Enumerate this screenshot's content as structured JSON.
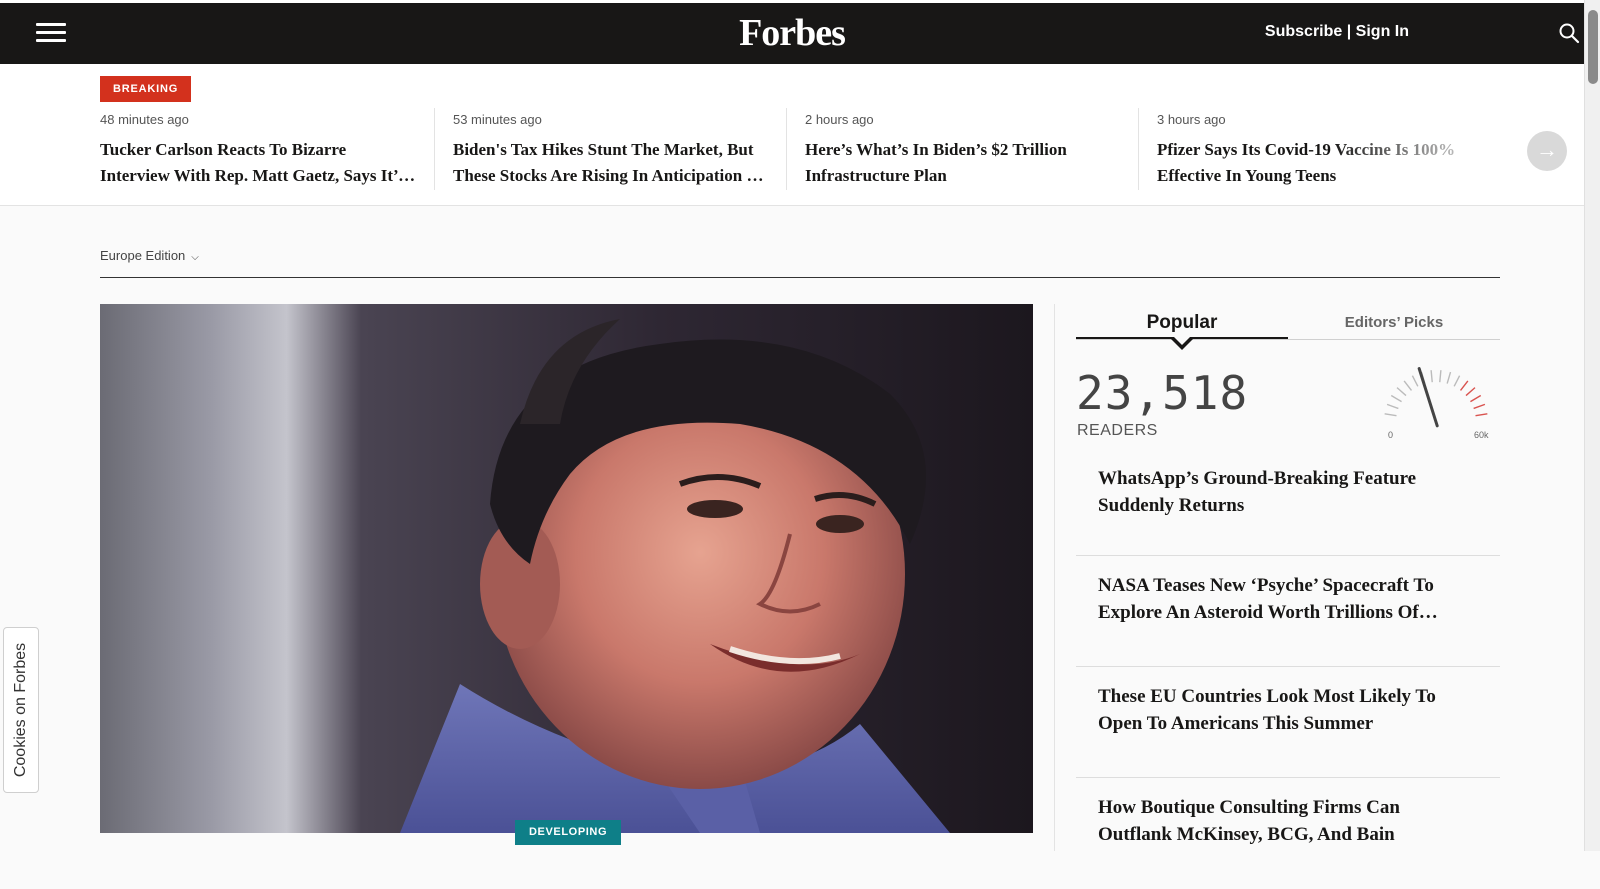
{
  "header": {
    "logo_text": "Forbes",
    "subscribe_label": "Subscribe",
    "separator": "|",
    "sign_in_label": "Sign In"
  },
  "breaking": {
    "badge": "BREAKING",
    "next_arrow": "→",
    "items": [
      {
        "time": "48 minutes ago",
        "title": "Tucker Carlson Reacts To Bizarre Interview With Rep. Matt Gaetz, Says It’s One Of The Weirdest He’s Done"
      },
      {
        "time": "53 minutes ago",
        "title": "Biden's Tax Hikes Stunt The Market, But These Stocks Are Rising In Anticipation Of The New Plan"
      },
      {
        "time": "2 hours ago",
        "title": "Here’s What’s In Biden’s $2 Trillion Infrastructure Plan"
      },
      {
        "time": "3 hours ago",
        "title": "Pfizer Says Its Covid-19 Vaccine Is 100% Effective In Young Teens"
      }
    ]
  },
  "edition": {
    "label": "Europe Edition",
    "chevron": "⌄"
  },
  "hero": {
    "badge": "DEVELOPING"
  },
  "cookies": {
    "label": "Cookies on Forbes"
  },
  "sidebar": {
    "tabs": [
      {
        "label": "Popular",
        "active": true
      },
      {
        "label": "Editors’ Picks",
        "active": false
      }
    ],
    "readers_count": "23,518",
    "readers_label": "READERS",
    "gauge": {
      "min_label": "0",
      "max_label": "60k",
      "value": 23518,
      "max": 60000
    },
    "popular": [
      {
        "title": "WhatsApp’s Ground-Breaking Feature Suddenly Returns"
      },
      {
        "title": "NASA Teases New ‘Psyche’ Spacecraft To Explore An Asteroid Worth Trillions Of Dollars"
      },
      {
        "title": "These EU Countries Look Most Likely To Open To Americans This Summer"
      },
      {
        "title": "How Boutique Consulting Firms Can Outflank McKinsey, BCG, And Bain"
      }
    ]
  },
  "colors": {
    "topbar": "#181716",
    "breaking_red": "#d3311d",
    "developing_teal": "#0e7f88",
    "gauge_red": "#d9534f"
  }
}
